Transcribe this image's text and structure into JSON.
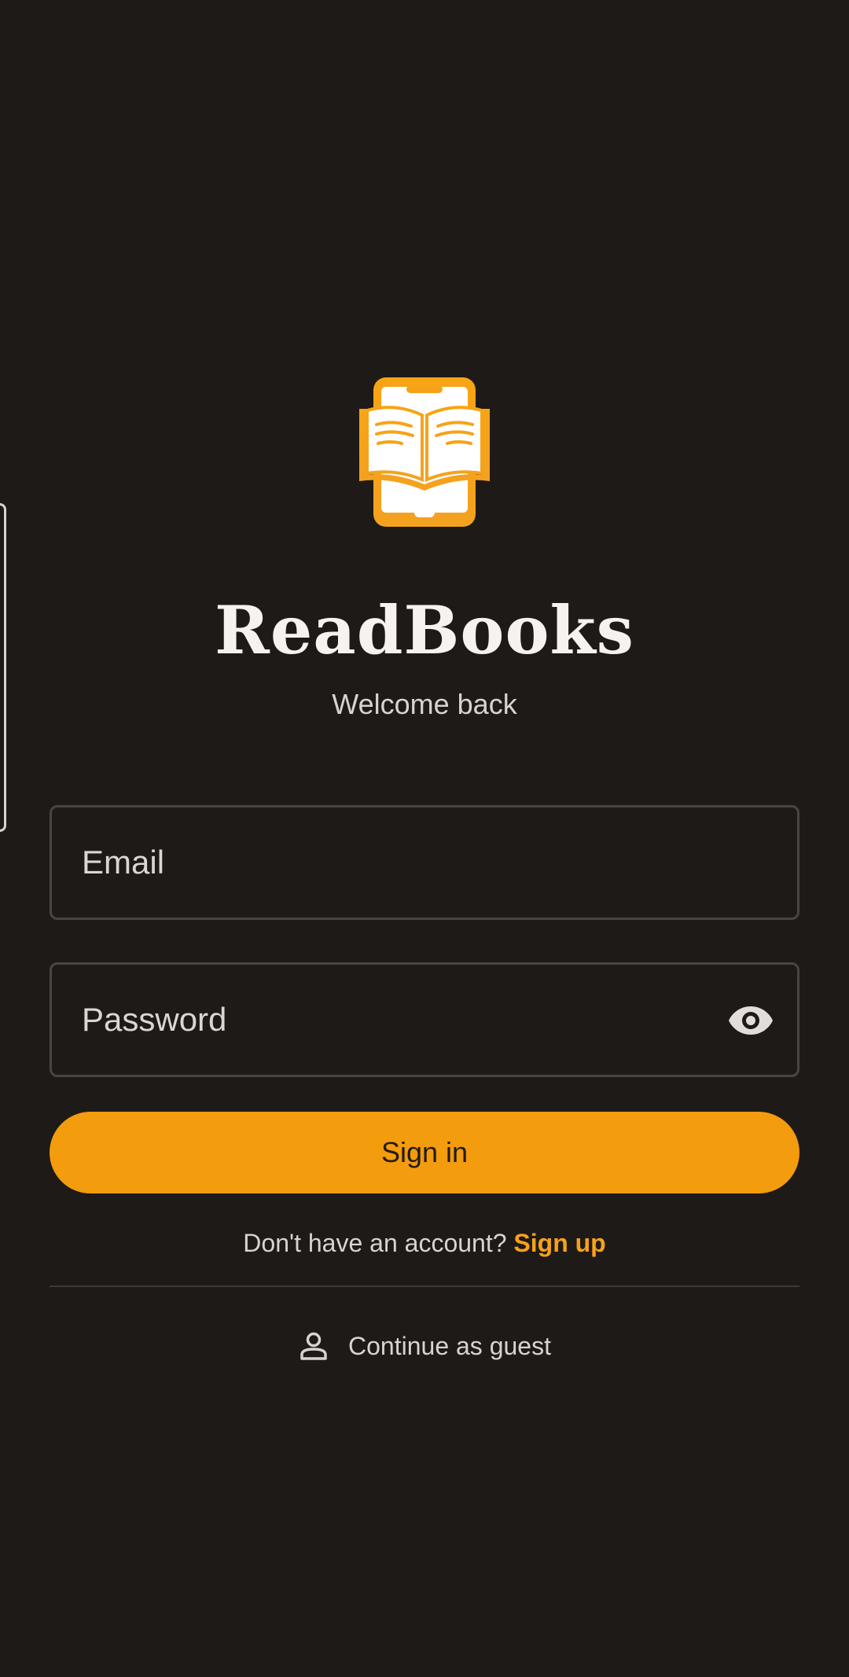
{
  "app": {
    "title": "ReadBooks",
    "subtitle": "Welcome back",
    "logo_icon": "book-phone-icon"
  },
  "form": {
    "email_placeholder": "Email",
    "password_placeholder": "Password",
    "password_toggle_icon": "eye-icon",
    "signin_label": "Sign in"
  },
  "signup": {
    "prompt": "Don't have an account?",
    "link_label": "Sign up"
  },
  "guest": {
    "label": "Continue as guest",
    "icon": "person-icon"
  },
  "colors": {
    "background": "#1e1a18",
    "accent": "#f39c0d",
    "link": "#f6a21a",
    "field_border": "#4a4543"
  }
}
